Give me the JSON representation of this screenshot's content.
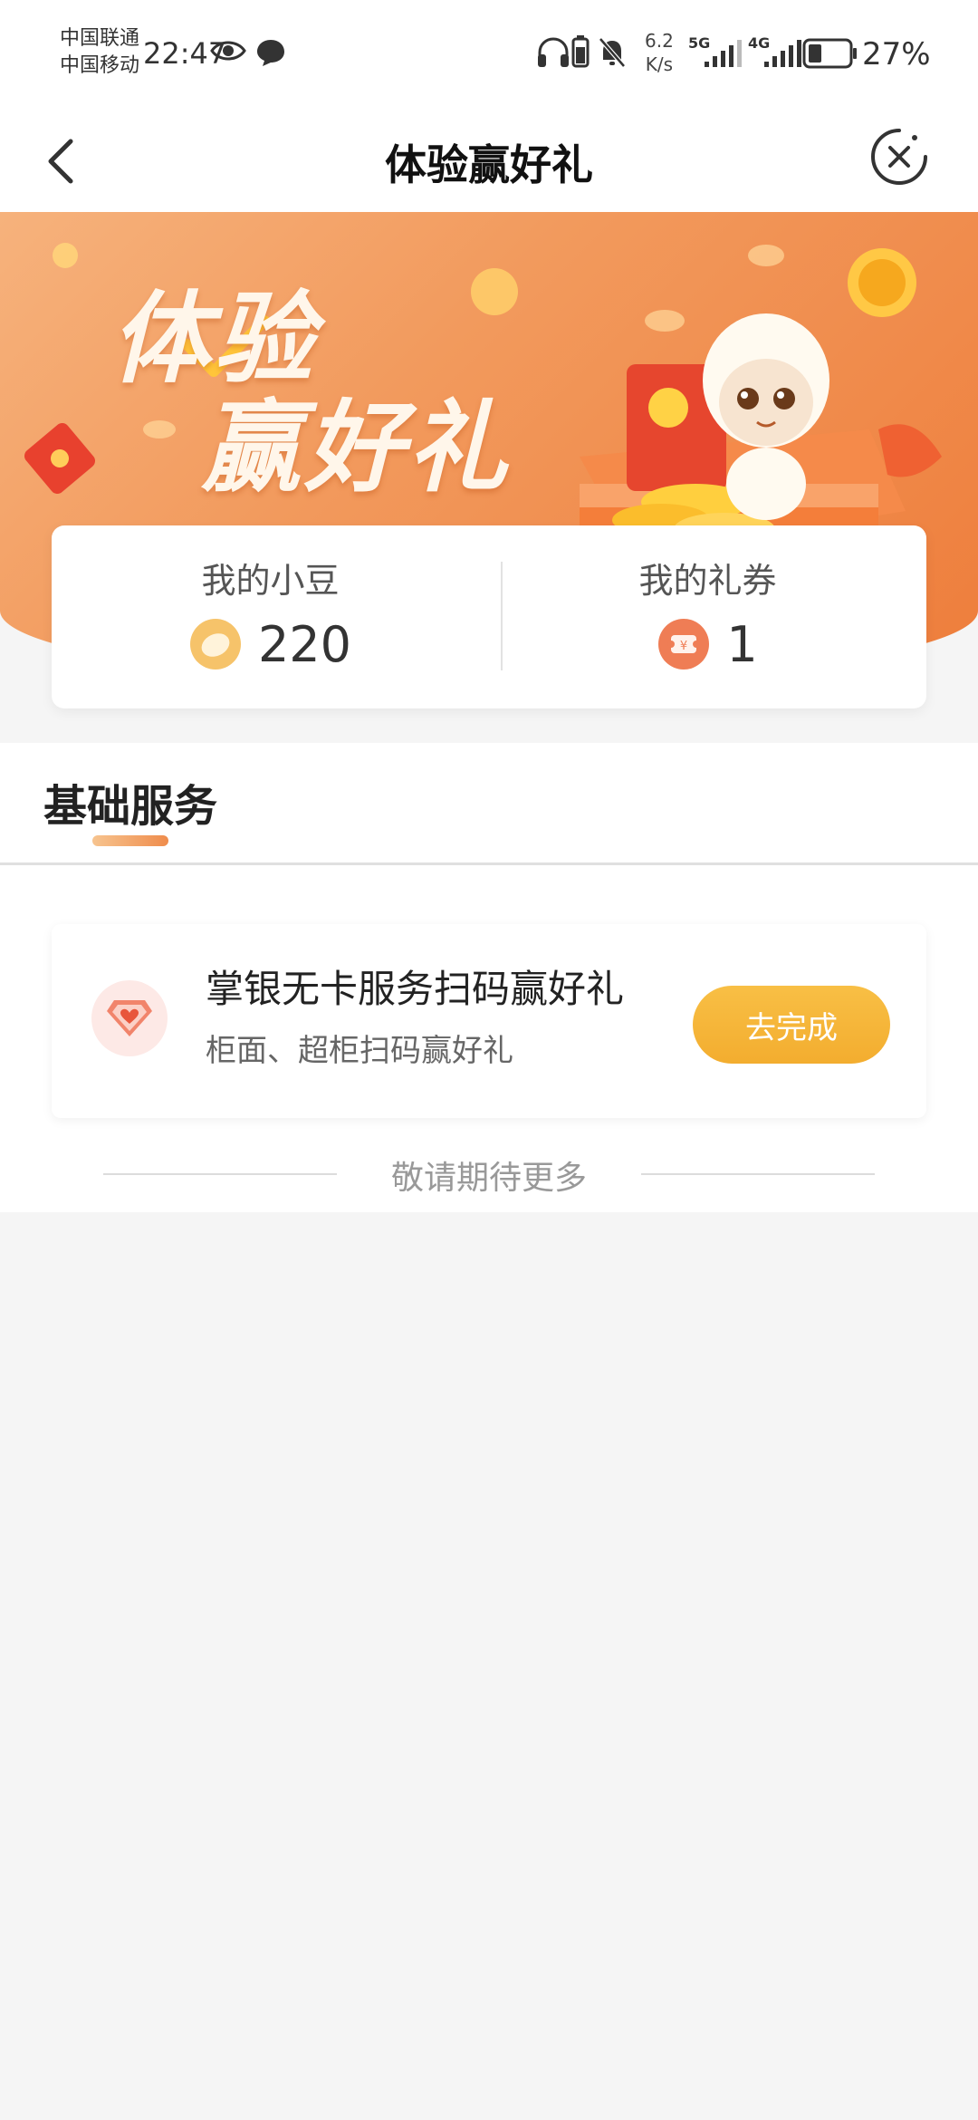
{
  "status_bar": {
    "carrier_1": "中国联通",
    "carrier_2": "中国移动",
    "time": "22:47",
    "net_speed_value": "6.2",
    "net_speed_unit": "K/s",
    "signal_1": "5G",
    "signal_2": "4G",
    "battery": "27%"
  },
  "header": {
    "title": "体验赢好礼"
  },
  "banner": {
    "title_line1": "体验",
    "title_line2": "赢好礼"
  },
  "stats": {
    "beans_label": "我的小豆",
    "beans_value": "220",
    "coupons_label": "我的礼券",
    "coupons_value": "1"
  },
  "section": {
    "title": "基础服务"
  },
  "tasks": [
    {
      "title": "掌银无卡服务扫码赢好礼",
      "subtitle": "柜面、超柜扫码赢好礼",
      "button": "去完成"
    }
  ],
  "footer": {
    "more_text": "敬请期待更多"
  },
  "colors": {
    "accent_orange": "#ee7d3b",
    "button_yellow": "#f3ad2f"
  }
}
